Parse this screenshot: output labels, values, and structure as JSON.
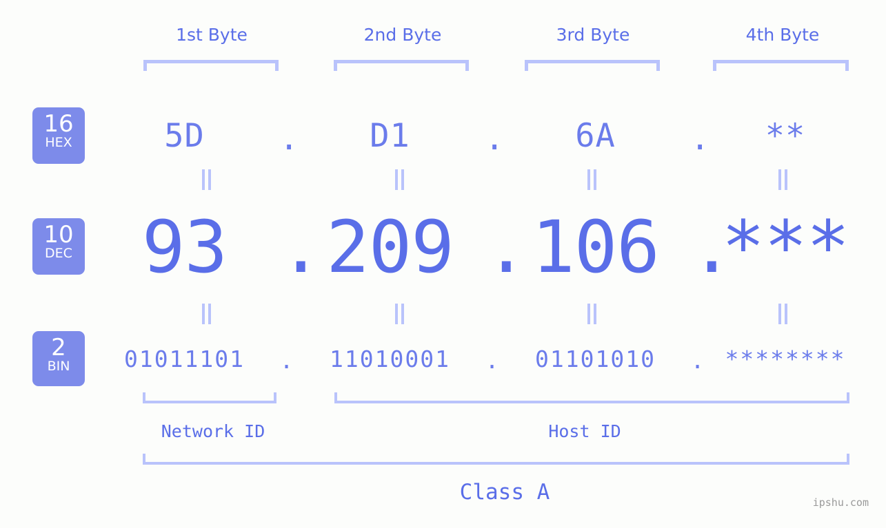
{
  "meta": {
    "accent": "#5a6ee8",
    "accent_light": "#b9c3fb",
    "badge_bg": "#7d8bea",
    "background": "#fcfdfb",
    "watermark_color": "#9a9a9a"
  },
  "byte_headers": [
    {
      "label": "1st Byte"
    },
    {
      "label": "2nd Byte"
    },
    {
      "label": "3rd Byte"
    },
    {
      "label": "4th Byte"
    }
  ],
  "bases": [
    {
      "id": "hex",
      "number": "16",
      "name": "HEX"
    },
    {
      "id": "dec",
      "number": "10",
      "name": "DEC"
    },
    {
      "id": "bin",
      "number": "2",
      "name": "BIN"
    }
  ],
  "rows": {
    "hex": {
      "base_number": "16",
      "base_name": "HEX",
      "values": [
        "5D",
        "D1",
        "6A",
        "**"
      ],
      "separator": "."
    },
    "dec": {
      "base_number": "10",
      "base_name": "DEC",
      "values": [
        "93",
        "209",
        "106",
        "***"
      ],
      "separator": "."
    },
    "bin": {
      "base_number": "2",
      "base_name": "BIN",
      "values": [
        "01011101",
        "11010001",
        "01101010",
        "********"
      ],
      "separator": "."
    }
  },
  "equals_marks": {
    "glyph": "||",
    "rows": 2,
    "columns": 4
  },
  "footer": {
    "network_id_label": "Network ID",
    "host_id_label": "Host ID",
    "class_label": "Class A"
  },
  "watermark": {
    "text": "ipshu.com"
  }
}
